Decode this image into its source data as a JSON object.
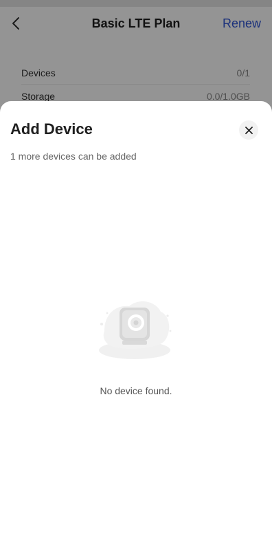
{
  "header": {
    "title": "Basic LTE Plan",
    "renew_label": "Renew"
  },
  "plan_info": {
    "rows": [
      {
        "label": "Devices",
        "value": "0/1"
      },
      {
        "label": "Storage",
        "value": "0.0/1.0GB"
      }
    ]
  },
  "sheet": {
    "title": "Add Device",
    "subtitle": "1 more devices can be added",
    "empty_message": "No device found."
  },
  "icons": {
    "back": "chevron-left-icon",
    "close": "close-icon",
    "empty": "camera-device-illustration-icon"
  },
  "colors": {
    "accent": "#2f55d4",
    "overlay": "#6b6b6b"
  }
}
